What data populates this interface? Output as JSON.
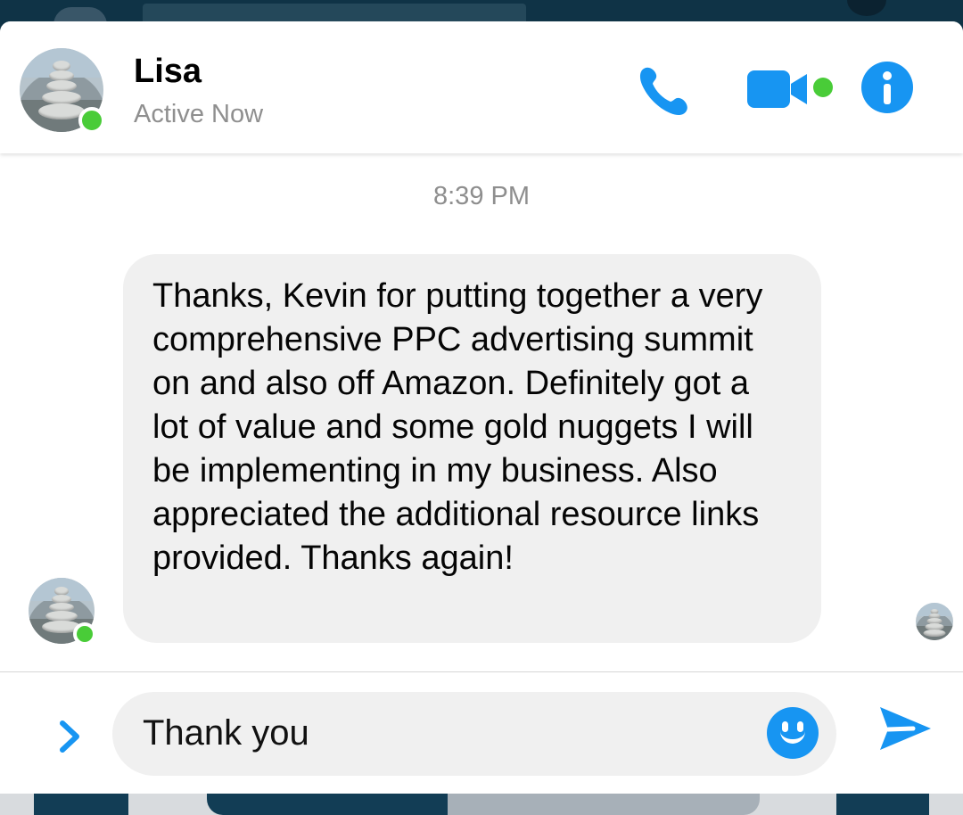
{
  "background": {
    "blur_color": "#123447"
  },
  "chat": {
    "contact": {
      "name": "Lisa",
      "status": "Active Now",
      "avatar_icon": "stone-stack-avatar",
      "online_color": "#49cc38"
    },
    "header_actions": {
      "phone_icon": "phone-icon",
      "video_icon": "video-camera-icon",
      "info_icon": "info-icon",
      "accent_color": "#1795f2"
    },
    "timestamp": "8:39 PM",
    "message": {
      "text": "Thanks, Kevin for putting together a very comprehensive PPC advertising summit on and also off Amazon. Definitely got a lot of value and some gold nuggets I will be implementing in my business. Also appreciated the additional resource links provided. Thanks again!"
    },
    "composer": {
      "value": "Thank you",
      "expand_icon": "chevron-right-icon",
      "emoji_icon": "smiley-icon",
      "send_icon": "send-icon"
    }
  }
}
